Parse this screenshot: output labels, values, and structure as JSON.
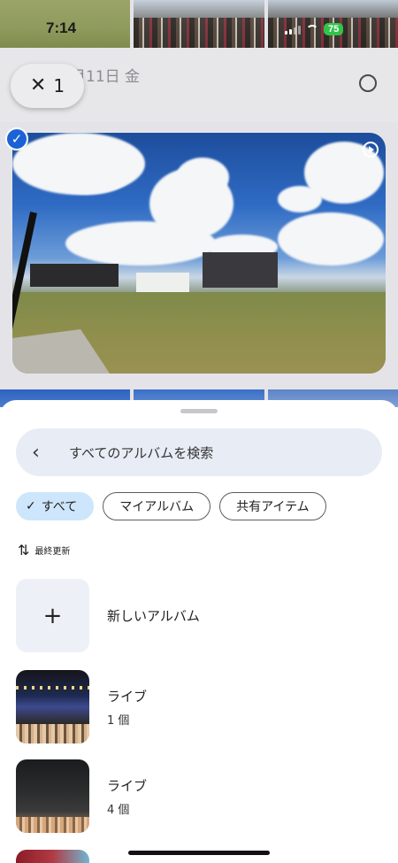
{
  "status_bar": {
    "time": "7:14",
    "battery": "75"
  },
  "selection": {
    "count": "1",
    "date_header": "月11日 金"
  },
  "sheet": {
    "search_label": "すべてのアルバムを検索",
    "filters": [
      "すべて",
      "マイアルバム",
      "共有アイテム"
    ],
    "active_filter": "すべて",
    "sort_label": "最終更新",
    "new_album_label": "新しいアルバム",
    "albums": [
      {
        "title": "ライブ",
        "count": "1 個"
      },
      {
        "title": "ライブ",
        "count": "4 個"
      }
    ]
  },
  "icons": {
    "close": "close-icon",
    "back": "chevron-left-icon",
    "check": "check-icon",
    "sort": "sort-arrows-icon",
    "add": "plus-icon",
    "play": "play-circle-icon"
  },
  "colors": {
    "accent": "#1a62d6",
    "chip_active_bg": "#cde6fb",
    "search_bg": "#e8edf5",
    "battery": "#31c34a"
  }
}
